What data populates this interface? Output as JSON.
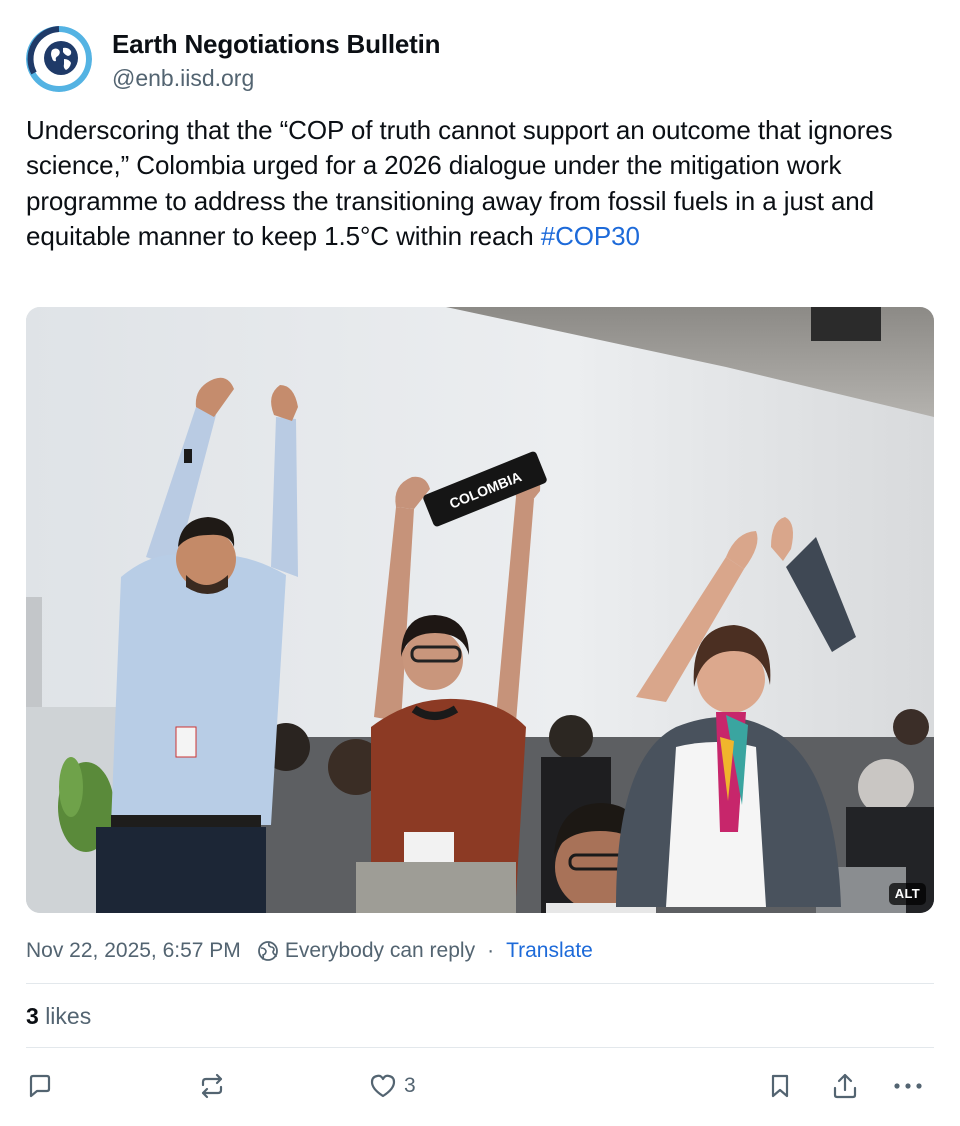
{
  "author": {
    "display_name": "Earth Negotiations Bulletin",
    "handle": "@enb.iisd.org"
  },
  "post": {
    "text": "Underscoring that the “COP of truth cannot support an outcome that ignores science,” Colombia urged for a 2026 dialogue under the mitigation work programme to address the transitioning away from fossil fuels in a just and equitable manner to keep 1.5°C within reach ",
    "hashtag": "#COP30",
    "image": {
      "sign_text": "COLOMBIA",
      "alt_badge": "ALT"
    }
  },
  "meta": {
    "timestamp": "Nov 22, 2025, 6:57 PM",
    "reply_setting": "Everybody can reply",
    "separator": "·",
    "translate": "Translate"
  },
  "likes": {
    "count": "3",
    "label": "likes"
  },
  "actions": {
    "like_count": "3",
    "icons": [
      "reply-icon",
      "repost-icon",
      "heart-icon",
      "bookmark-icon",
      "share-icon",
      "more-icon"
    ]
  },
  "colors": {
    "text": "#0b0f14",
    "secondary": "#536471",
    "link": "#1d6ad9",
    "divider": "#e3e8ec"
  }
}
